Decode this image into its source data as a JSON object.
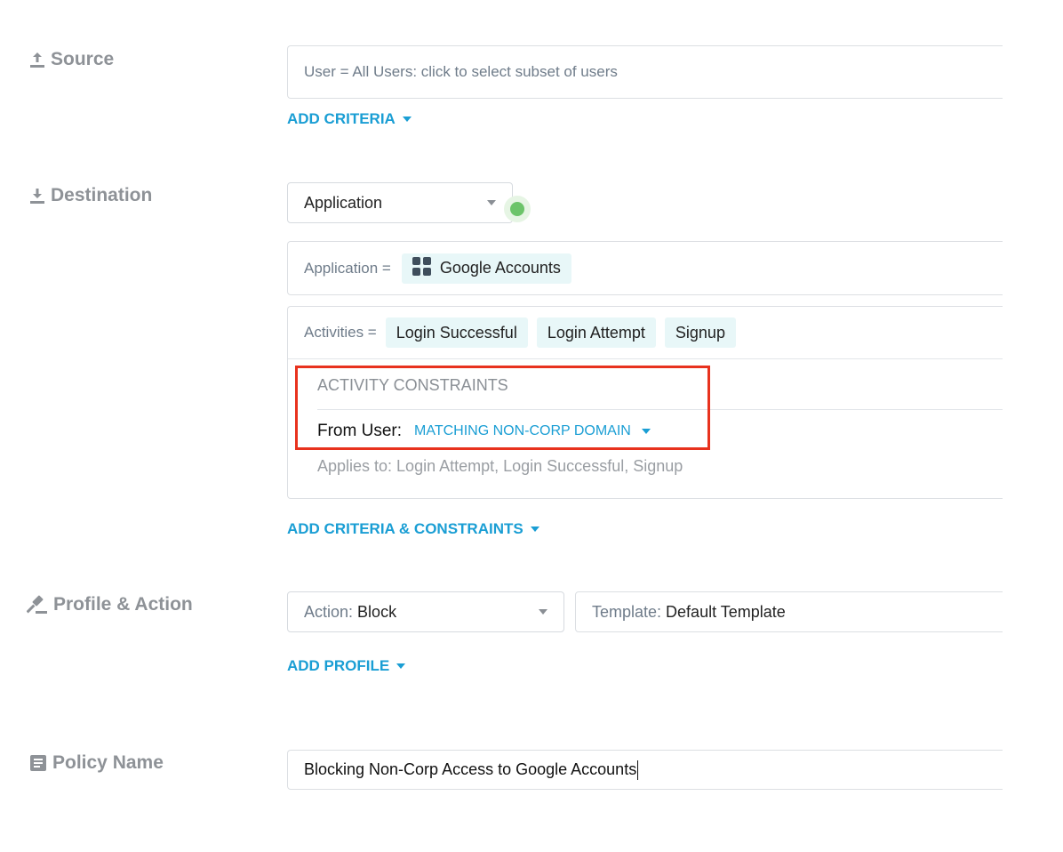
{
  "source": {
    "label": "Source",
    "user_field": "User = All Users: click to select subset of users",
    "add_criteria": "ADD CRITERIA"
  },
  "destination": {
    "label": "Destination",
    "type_select": "Application",
    "application": {
      "prefix": "Application =",
      "value": "Google Accounts"
    },
    "activities": {
      "prefix": "Activities =",
      "chips": [
        "Login Successful",
        "Login Attempt",
        "Signup"
      ]
    },
    "constraints": {
      "heading": "ACTIVITY CONSTRAINTS",
      "from_user_label": "From User:",
      "from_user_value": "MATCHING NON-CORP DOMAIN",
      "applies_to": "Applies to: Login Attempt, Login Successful, Signup"
    },
    "add_criteria_constraints": "ADD CRITERIA & CONSTRAINTS"
  },
  "profile_action": {
    "label": "Profile & Action",
    "action_prefix": "Action:",
    "action_value": "Block",
    "template_prefix": "Template:",
    "template_value": "Default Template",
    "add_profile": "ADD PROFILE"
  },
  "policy_name": {
    "label": "Policy Name",
    "value": "Blocking Non-Corp Access to Google Accounts"
  },
  "colors": {
    "accent": "#1a9ed4",
    "highlight_box": "#e8321e",
    "status_dot": "#6cc46a",
    "chip_bg": "#e8f7f8"
  }
}
